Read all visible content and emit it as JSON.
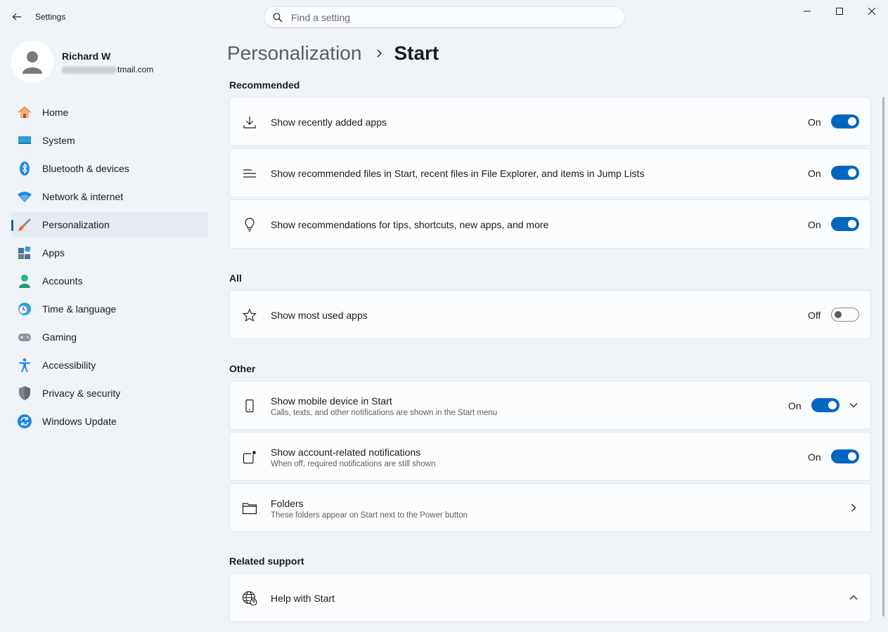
{
  "window": {
    "title": "Settings",
    "search_placeholder": "Find a setting"
  },
  "user": {
    "name": "Richard W",
    "email_visible": "tmail.com"
  },
  "sidebar": {
    "items": [
      {
        "label": "Home",
        "icon": "home-icon"
      },
      {
        "label": "System",
        "icon": "system-icon"
      },
      {
        "label": "Bluetooth & devices",
        "icon": "bluetooth-icon"
      },
      {
        "label": "Network & internet",
        "icon": "wifi-icon"
      },
      {
        "label": "Personalization",
        "icon": "brush-icon",
        "active": true
      },
      {
        "label": "Apps",
        "icon": "apps-icon"
      },
      {
        "label": "Accounts",
        "icon": "accounts-icon"
      },
      {
        "label": "Time & language",
        "icon": "time-language-icon"
      },
      {
        "label": "Gaming",
        "icon": "gamepad-icon"
      },
      {
        "label": "Accessibility",
        "icon": "accessibility-icon"
      },
      {
        "label": "Privacy & security",
        "icon": "shield-icon"
      },
      {
        "label": "Windows Update",
        "icon": "update-icon"
      }
    ]
  },
  "breadcrumb": {
    "parent": "Personalization",
    "current": "Start"
  },
  "sections": {
    "recommended": "Recommended",
    "all": "All",
    "other": "Other",
    "related_support": "Related support"
  },
  "settings": {
    "recent_apps": {
      "title": "Show recently added apps",
      "state": "On"
    },
    "recommended_files": {
      "title": "Show recommended files in Start, recent files in File Explorer, and items in Jump Lists",
      "state": "On"
    },
    "recommendations_tips": {
      "title": "Show recommendations for tips, shortcuts, new apps, and more",
      "state": "On"
    },
    "most_used": {
      "title": "Show most used apps",
      "state": "Off"
    },
    "mobile_device": {
      "title": "Show mobile device in Start",
      "desc": "Calls, texts, and other notifications are shown in the Start menu",
      "state": "On"
    },
    "account_notifications": {
      "title": "Show account-related notifications",
      "desc": "When off, required notifications are still shown",
      "state": "On"
    },
    "folders": {
      "title": "Folders",
      "desc": "These folders appear on Start next to the Power button"
    },
    "help_start": {
      "title": "Help with Start"
    }
  },
  "colors": {
    "accent": "#0067c0",
    "background": "#f0f4f9",
    "card": "#fbfcfe"
  }
}
